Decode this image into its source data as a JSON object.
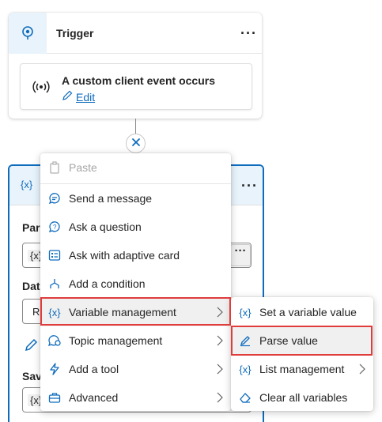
{
  "colors": {
    "accent": "#0f6cbd",
    "highlight": "#e03c3c"
  },
  "trigger": {
    "title": "Trigger",
    "more": "···",
    "event_title": "A custom client event occurs",
    "edit_label": "Edit"
  },
  "var_node": {
    "icon": "{x}",
    "more": "···",
    "labels": [
      "Pars",
      "Data",
      "Save"
    ],
    "field_values": [
      "{x}",
      "Re",
      "{x}"
    ],
    "field_more": "···"
  },
  "context_menu": {
    "items": [
      {
        "label": "Paste",
        "icon": "paste-icon",
        "disabled": true
      },
      {
        "label": "Send a message",
        "icon": "chat-bubble-icon"
      },
      {
        "label": "Ask a question",
        "icon": "question-bubble-icon"
      },
      {
        "label": "Ask with adaptive card",
        "icon": "adaptive-card-icon"
      },
      {
        "label": "Add a condition",
        "icon": "branch-icon"
      },
      {
        "label": "Variable management",
        "icon": "variable-icon",
        "icon_text": "{x}",
        "submenu": true,
        "highlighted": true
      },
      {
        "label": "Topic management",
        "icon": "topic-gear-icon",
        "submenu": true
      },
      {
        "label": "Add a tool",
        "icon": "lightning-icon",
        "submenu": true
      },
      {
        "label": "Advanced",
        "icon": "toolbox-icon",
        "submenu": true
      }
    ]
  },
  "submenu": {
    "items": [
      {
        "label": "Set a variable value",
        "icon": "variable-icon",
        "icon_text": "{x}"
      },
      {
        "label": "Parse value",
        "icon": "parse-icon",
        "highlighted": true
      },
      {
        "label": "List management",
        "icon": "variable-icon",
        "icon_text": "{x}",
        "submenu": true
      },
      {
        "label": "Clear all variables",
        "icon": "eraser-icon"
      }
    ]
  }
}
